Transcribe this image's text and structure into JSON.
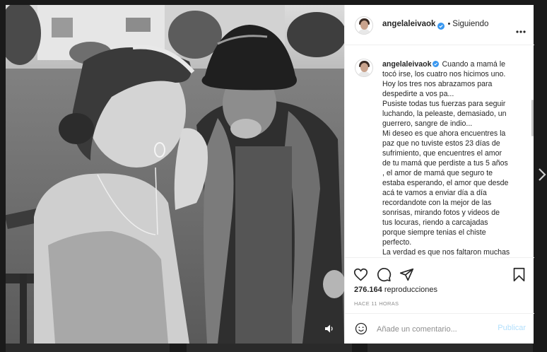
{
  "post": {
    "username": "angelaleivaok",
    "follow_state": "Siguiendo",
    "separator": "•",
    "caption_lines": [
      "Cuando a mamá le",
      "tocó irse, los cuatro nos hicimos uno.",
      "Hoy los tres nos abrazamos para",
      "despedirte a vos pa...",
      "Pusiste todas tus fuerzas para seguir",
      "luchando, la peleaste, demasiado, un",
      "guerrero, sangre de indio...",
      "Mi deseo es que ahora encuentres la",
      "paz que no tuviste estos 23 días de",
      "sufrimiento, que encuentres el amor",
      "de tu mamá que perdiste a tus 5 años",
      ", el amor de mamá que seguro te",
      "estaba esperando, el amor que desde",
      "acá te vamos a enviar día a día",
      "recordandote con la mejor de las",
      "sonrisas, mirando fotos y videos de",
      "tus locuras, riendo a carcajadas",
      "porque siempre tenias el chiste",
      "perfecto.",
      "La verdad es que nos faltaron muchas"
    ],
    "views_count": "276.164",
    "views_label": "reproducciones",
    "timestamp": "HACE 11 HORAS"
  },
  "comment": {
    "placeholder": "Añade un comentario...",
    "publish_label": "Publicar"
  },
  "icons": {
    "like": "heart-icon",
    "comment": "comment-icon",
    "share": "share-icon",
    "save": "bookmark-icon",
    "more": "more-options-icon",
    "verified": "verified-badge-icon",
    "volume": "volume-icon",
    "emoji": "emoji-icon",
    "next": "chevron-right-icon"
  },
  "colors": {
    "verified": "#3897f0",
    "publish_disabled": "#b2dffc",
    "muted_text": "#8e8e8e"
  }
}
